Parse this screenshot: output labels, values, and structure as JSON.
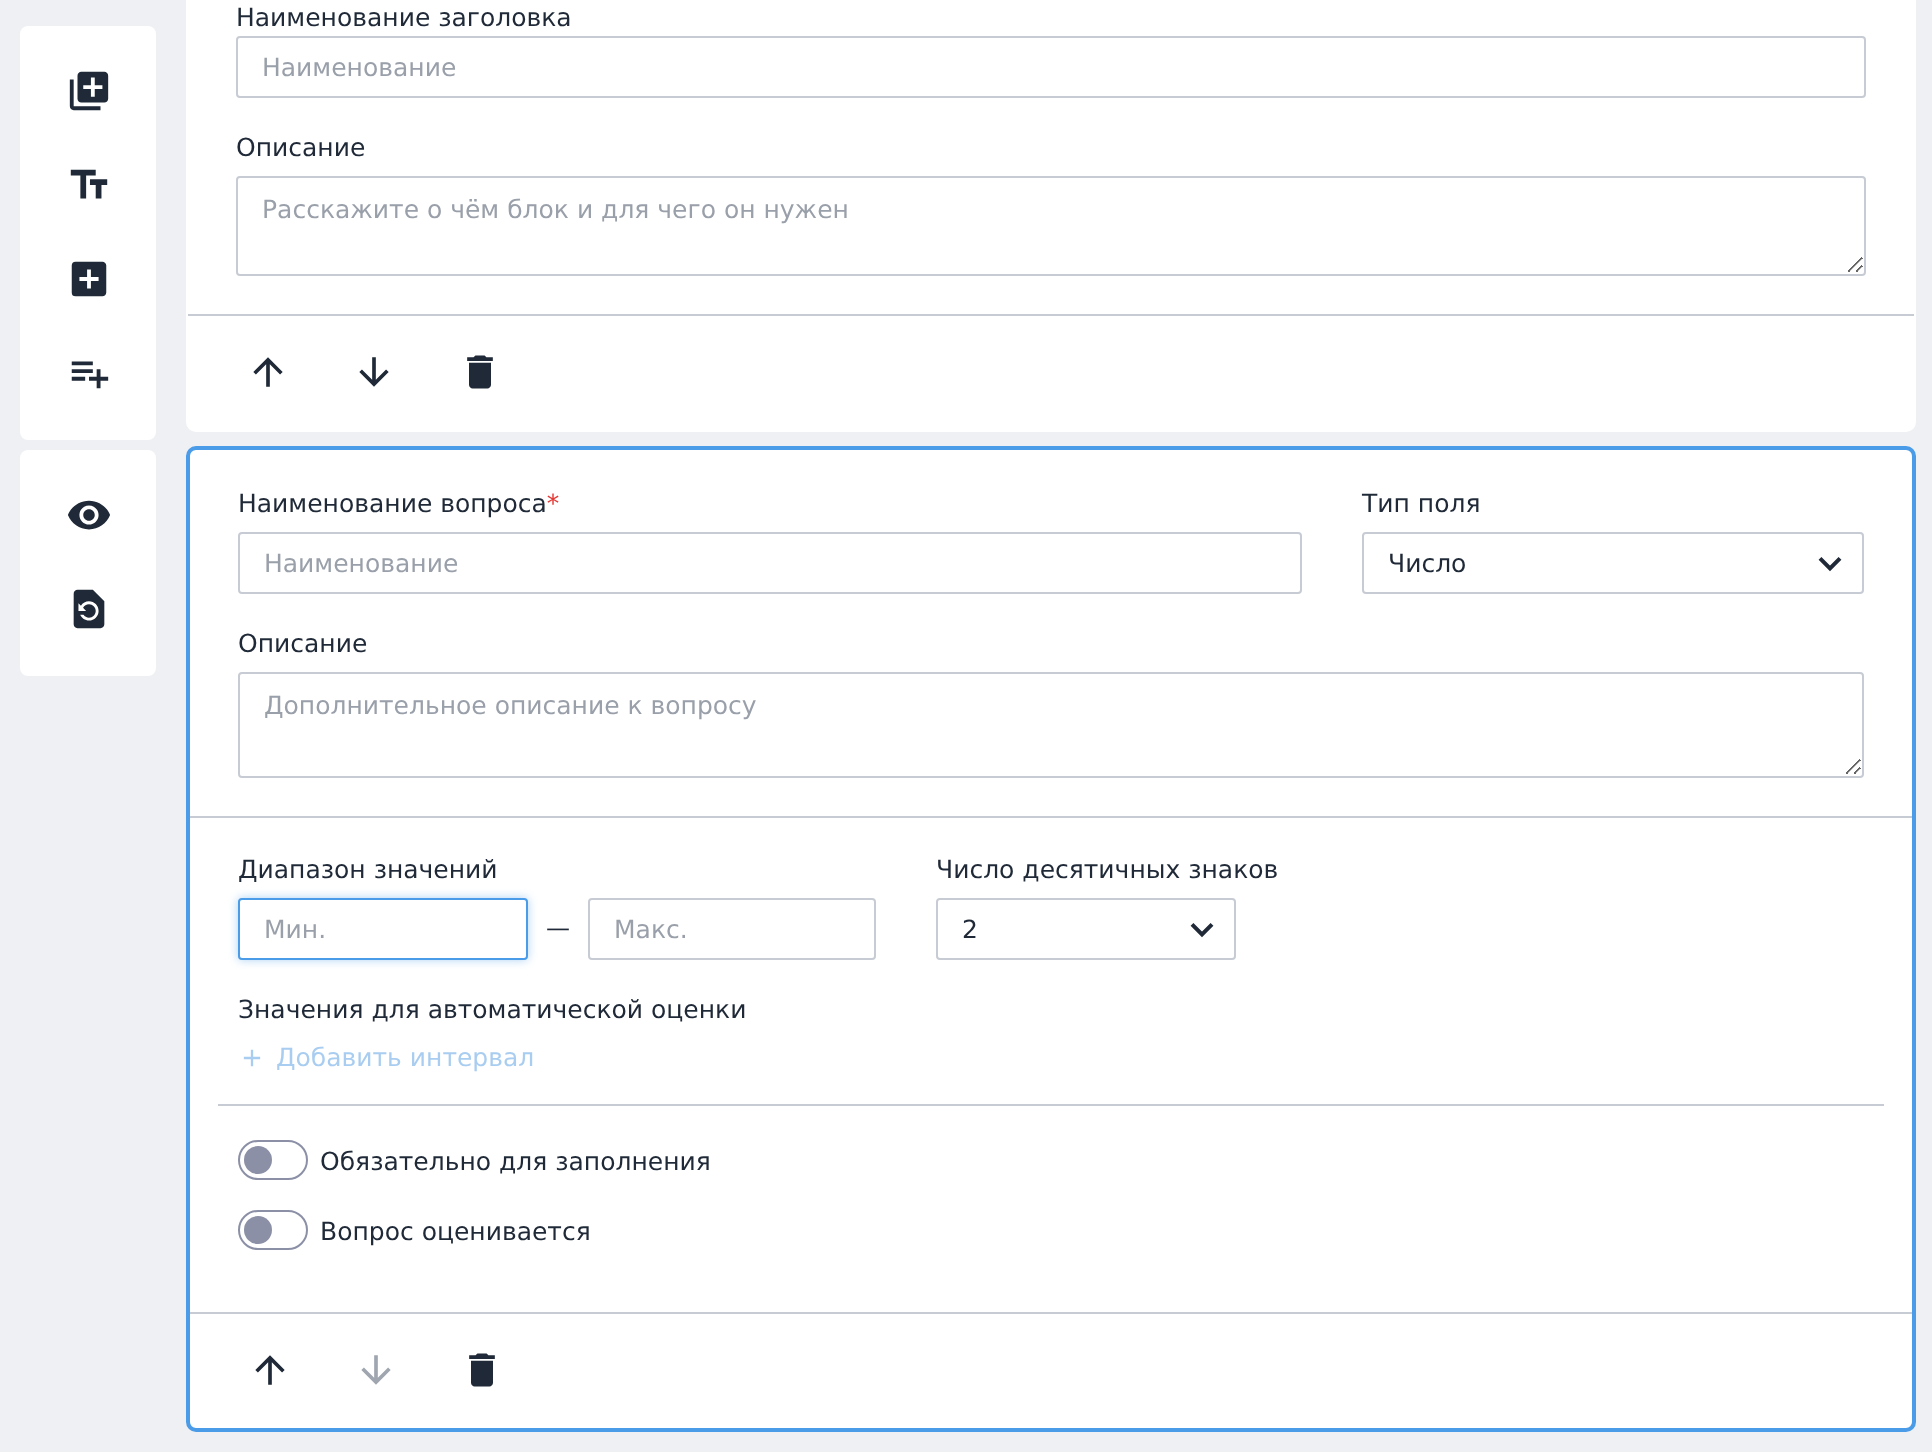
{
  "header_block": {
    "title_label": "Наименование заголовка",
    "title_placeholder": "Наименование",
    "description_label": "Описание",
    "description_placeholder": "Расскажите о чём блок и для чего он нужен",
    "active": false,
    "actions": [
      {
        "kind": "up",
        "disabled": false
      },
      {
        "kind": "down",
        "disabled": false
      },
      {
        "kind": "delete",
        "disabled": false
      }
    ]
  },
  "question_block": {
    "active": true,
    "name_label": "Наименование вопроса",
    "required_mark": "*",
    "name_placeholder": "Наименование",
    "type_label": "Тип поля",
    "type_value": "Число",
    "description_label": "Описание",
    "description_placeholder": "Дополнительное описание к вопросу",
    "range_label": "Диапазон значений",
    "min_placeholder": "Мин.",
    "min_focused": true,
    "range_separator": "—",
    "max_placeholder": "Макс.",
    "max_focused": false,
    "decimals_label": "Число десятичных знаков",
    "decimals_value": "2",
    "auto_label": "Значения для автоматической оценки",
    "add_interval": {
      "label": "Добавить интервал",
      "disabled": true
    },
    "toggles": [
      {
        "label": "Обязательно для заполнения",
        "on": false
      },
      {
        "label": "Вопрос оценивается",
        "on": false
      }
    ],
    "actions": [
      {
        "kind": "up",
        "disabled": false
      },
      {
        "kind": "down",
        "disabled": true
      },
      {
        "kind": "delete",
        "disabled": false
      }
    ]
  }
}
